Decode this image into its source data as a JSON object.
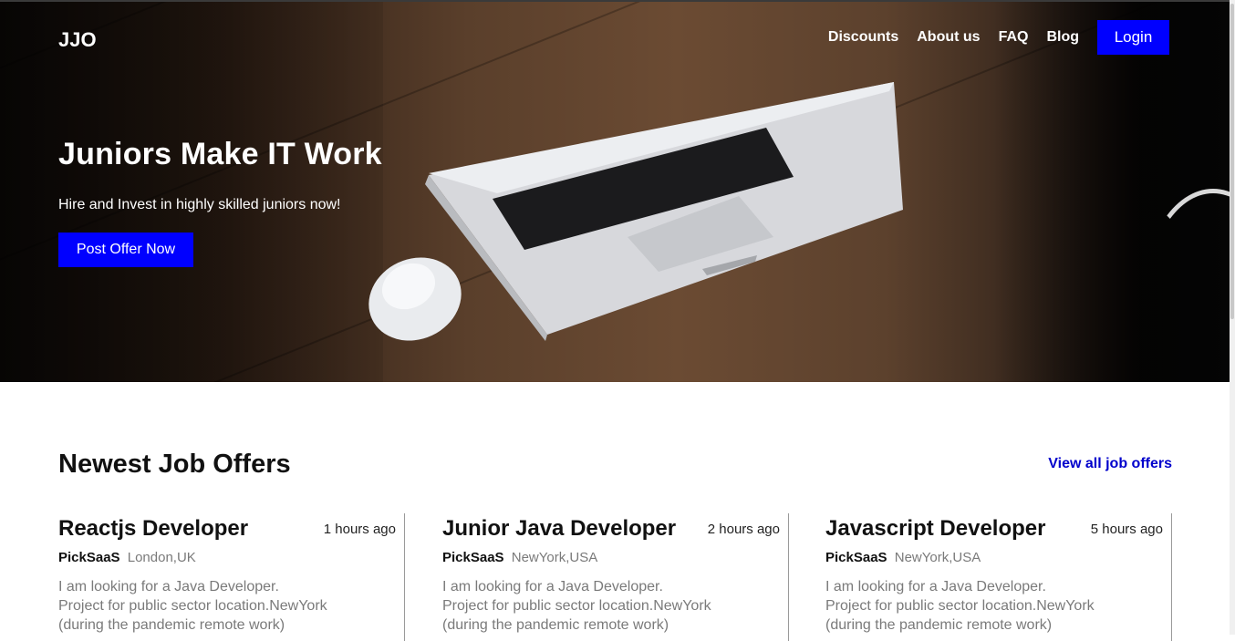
{
  "header": {
    "brand": "JJO",
    "nav": [
      {
        "label": "Discounts"
      },
      {
        "label": "About us"
      },
      {
        "label": "FAQ"
      },
      {
        "label": "Blog"
      }
    ],
    "login_label": "Login"
  },
  "hero": {
    "title": "Juniors Make IT Work",
    "subtitle": "Hire and Invest in highly skilled juniors now!",
    "cta_label": "Post Offer Now"
  },
  "jobs": {
    "section_title": "Newest Job Offers",
    "view_all_label": "View all job offers",
    "items": [
      {
        "title": "Reactjs Developer",
        "time": "1 hours ago",
        "company": "PickSaaS",
        "location": "London,UK",
        "description_lines": [
          "I am looking for a Java Developer.",
          "Project for public sector location.NewYork",
          "(during the pandemic remote work)"
        ]
      },
      {
        "title": "Junior Java Developer",
        "time": "2 hours ago",
        "company": "PickSaaS",
        "location": "NewYork,USA",
        "description_lines": [
          "I am looking for a Java Developer.",
          "Project for public sector location.NewYork",
          "(during the pandemic remote work)"
        ]
      },
      {
        "title": "Javascript Developer",
        "time": "5 hours ago",
        "company": "PickSaaS",
        "location": "NewYork,USA",
        "description_lines": [
          "I am looking for a Java Developer.",
          "Project for public sector location.NewYork",
          "(during the pandemic remote work)"
        ]
      }
    ]
  },
  "colors": {
    "accent": "#0000ff",
    "link": "#0000cc",
    "muted_text": "#7a7a7a"
  }
}
